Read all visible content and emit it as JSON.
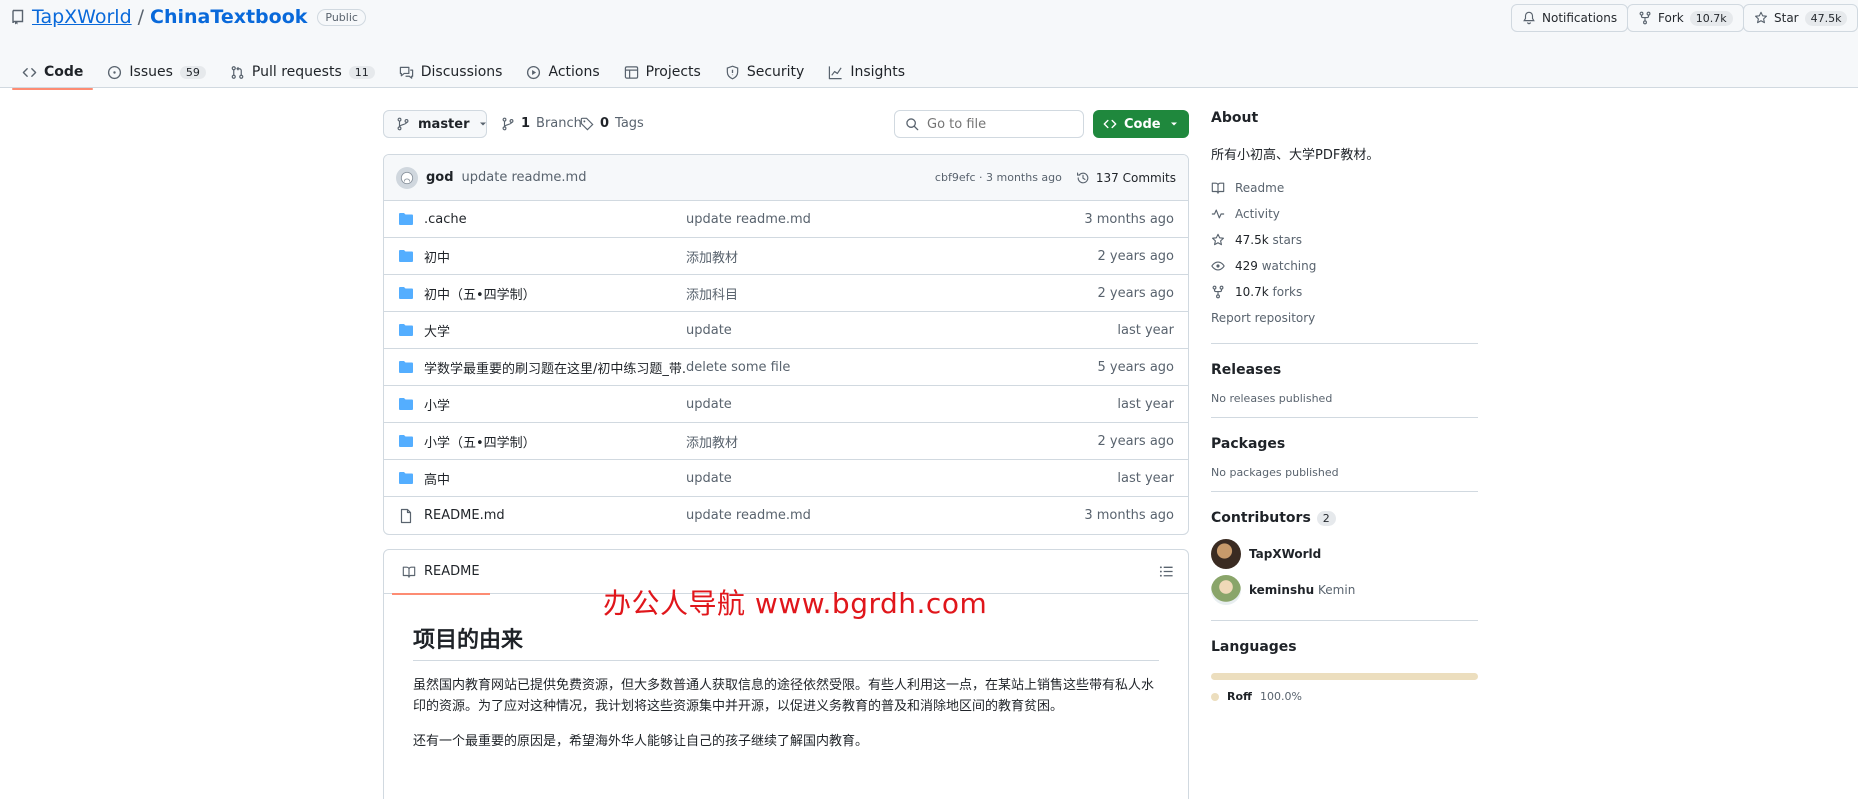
{
  "repo": {
    "owner": "TapXWorld",
    "separator": "/",
    "name": "ChinaTextbook",
    "visibility": "Public"
  },
  "header_buttons": {
    "notifications": "Notifications",
    "fork": "Fork",
    "fork_count": "10.7k",
    "star": "Star",
    "star_count": "47.5k"
  },
  "tabs": [
    {
      "label": "Code",
      "icon": "code-icon"
    },
    {
      "label": "Issues",
      "count": "59",
      "icon": "issue-icon"
    },
    {
      "label": "Pull requests",
      "count": "11",
      "icon": "pull-request-icon"
    },
    {
      "label": "Discussions",
      "icon": "discussion-icon"
    },
    {
      "label": "Actions",
      "icon": "play-icon"
    },
    {
      "label": "Projects",
      "icon": "table-icon"
    },
    {
      "label": "Security",
      "icon": "shield-icon"
    },
    {
      "label": "Insights",
      "icon": "graph-icon"
    }
  ],
  "toolbar": {
    "branch": "master",
    "branch_count": "1",
    "branch_label": "Branch",
    "tag_count": "0",
    "tag_label": "Tags",
    "goto_placeholder": "Go to file",
    "code_button": "Code"
  },
  "last_commit": {
    "author": "god",
    "message": "update readme.md",
    "sha_age": "cbf9efc · 3 months ago",
    "commits": "137 Commits"
  },
  "files": [
    {
      "name": ".cache",
      "type": "folder",
      "message": "update readme.md",
      "age": "3 months ago"
    },
    {
      "name": "初中",
      "type": "folder",
      "message": "添加教材",
      "age": "2 years ago"
    },
    {
      "name": "初中（五•四学制）",
      "type": "folder",
      "message": "添加科目",
      "age": "2 years ago"
    },
    {
      "name": "大学",
      "type": "folder",
      "message": "update",
      "age": "last year"
    },
    {
      "name": "学数学最重要的刷习题在这里/初中练习题_带...",
      "type": "folder",
      "message": "delete some file",
      "age": "5 years ago"
    },
    {
      "name": "小学",
      "type": "folder",
      "message": "update",
      "age": "last year"
    },
    {
      "name": "小学（五•四学制）",
      "type": "folder",
      "message": "添加教材",
      "age": "2 years ago"
    },
    {
      "name": "高中",
      "type": "folder",
      "message": "update",
      "age": "last year"
    },
    {
      "name": "README.md",
      "type": "file",
      "message": "update readme.md",
      "age": "3 months ago"
    }
  ],
  "readme": {
    "tab": "README",
    "h1": "项目的由来",
    "p1": "虽然国内教育网站已提供免费资源，但大多数普通人获取信息的途径依然受限。有些人利用这一点，在某站上销售这些带有私人水印的资源。为了应对这种情况，我计划将这些资源集中并开源，以促进义务教育的普及和消除地区间的教育贫困。",
    "p2": "还有一个最重要的原因是，希望海外华人能够让自己的孩子继续了解国内教育。"
  },
  "watermark": "办公人导航  www.bgrdh.com",
  "about": {
    "title": "About",
    "description": "所有小初高、大学PDF教材。",
    "readme": "Readme",
    "activity": "Activity",
    "stars_count": "47.5k",
    "stars": "stars",
    "watching_count": "429",
    "watching": "watching",
    "forks_count": "10.7k",
    "forks": "forks",
    "report": "Report repository"
  },
  "releases": {
    "title": "Releases",
    "empty": "No releases published"
  },
  "packages": {
    "title": "Packages",
    "empty": "No packages published"
  },
  "contributors": {
    "title": "Contributors",
    "count": "2",
    "list": [
      {
        "login": "TapXWorld",
        "name": ""
      },
      {
        "login": "keminshu",
        "name": "Kemin"
      }
    ]
  },
  "languages": {
    "title": "Languages",
    "items": [
      {
        "name": "Roff",
        "percent": "100.0%",
        "color": "#ecdebe",
        "fraction": 1.0
      }
    ]
  },
  "colors": {
    "accent": "#0969da",
    "green": "#1f883d",
    "tab_underline": "#fd8c73",
    "folder": "#54aeff"
  }
}
